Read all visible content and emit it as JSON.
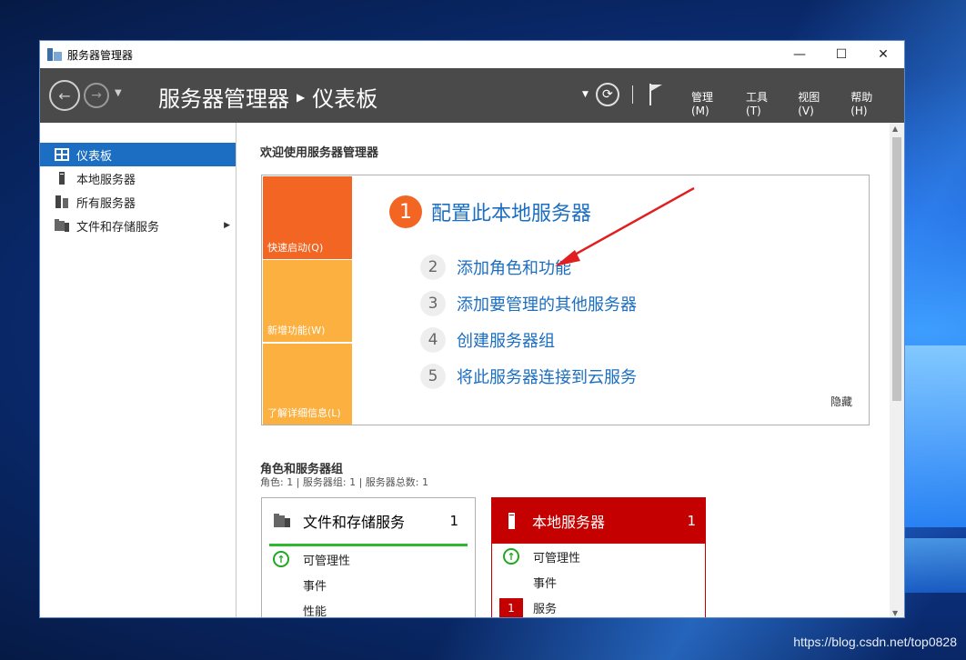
{
  "window": {
    "title": "服务器管理器"
  },
  "window_controls": {
    "minimize": "—",
    "maximize": "☐",
    "close": "✕"
  },
  "header": {
    "breadcrumb_root": "服务器管理器",
    "breadcrumb_current": "仪表板",
    "menus": [
      "管理(M)",
      "工具(T)",
      "视图(V)",
      "帮助(H)"
    ]
  },
  "sidebar": {
    "items": [
      {
        "label": "仪表板",
        "active": true
      },
      {
        "label": "本地服务器"
      },
      {
        "label": "所有服务器"
      },
      {
        "label": "文件和存储服务",
        "has_arrow": true
      }
    ]
  },
  "main": {
    "welcome_title": "欢迎使用服务器管理器",
    "tiles": [
      "快速启动(Q)",
      "新增功能(W)",
      "了解详细信息(L)"
    ],
    "step1": {
      "num": "1",
      "label": "配置此本地服务器"
    },
    "steps": [
      {
        "num": "2",
        "label": "添加角色和功能"
      },
      {
        "num": "3",
        "label": "添加要管理的其他服务器"
      },
      {
        "num": "4",
        "label": "创建服务器组"
      },
      {
        "num": "5",
        "label": "将此服务器连接到云服务"
      }
    ],
    "hide_label": "隐藏",
    "roles_title": "角色和服务器组",
    "roles_subtitle": "角色: 1 | 服务器组: 1 | 服务器总数: 1",
    "cards": [
      {
        "title": "文件和存储服务",
        "count": "1",
        "rows": [
          "可管理性",
          "事件",
          "性能"
        ]
      },
      {
        "title": "本地服务器",
        "count": "1",
        "rows": [
          "可管理性",
          "事件",
          "服务"
        ],
        "alert": "1"
      }
    ]
  },
  "desktop": {
    "watermark": "https://blog.csdn.net/top0828"
  },
  "colors": {
    "accent": "#1b6ec2",
    "orange": "#f26522",
    "amber": "#fbb040",
    "alert_red": "#c40000",
    "ok_green": "#21a821"
  }
}
